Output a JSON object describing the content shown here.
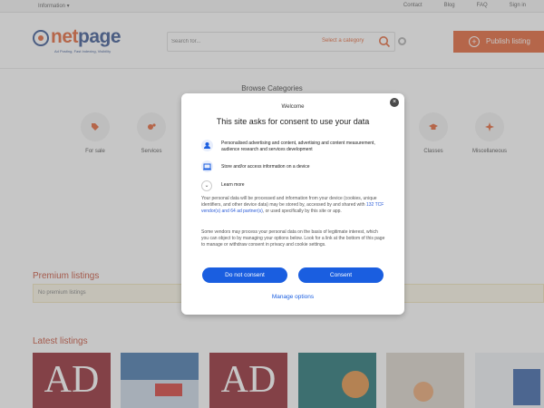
{
  "topbar": {
    "info_label": "Information",
    "links": [
      "Contact",
      "Blog",
      "FAQ",
      "Sign in"
    ]
  },
  "header": {
    "logo_part1": "net",
    "logo_part2": "page",
    "logo_tagline": "Ad Posting, Fast Indexing, Visibility",
    "search_placeholder": "Search for...",
    "category_select": "Select a category",
    "publish_label": "Publish listing",
    "accent_color": "#e25b2a"
  },
  "categories": {
    "title": "Browse Categories",
    "items": [
      {
        "label": "For sale",
        "icon": "tag-icon"
      },
      {
        "label": "Services",
        "icon": "gears-icon"
      },
      {
        "label": "Classes",
        "icon": "graduation-cap-icon"
      },
      {
        "label": "Miscellaneous",
        "icon": "burst-icon"
      }
    ]
  },
  "premium": {
    "title": "Premium listings",
    "empty_text": "No premium listings"
  },
  "latest": {
    "title": "Latest listings",
    "thumb_text": "AD",
    "thumb_text2": "AD"
  },
  "modal": {
    "welcome": "Welcome",
    "title": "This site asks for consent to use your data",
    "purpose1": "Personalised advertising and content, advertising and content measurement, audience research and services development",
    "purpose2": "Store and/or access information on a device",
    "learn_more": "Learn more",
    "para1_pre": "Your personal data will be processed and information from your device (cookies, unique identifiers, and other device data) may be stored by, accessed by and shared with ",
    "para1_link": "132 TCF vendor(s) and 64 ad partner(s)",
    "para1_post": ", or used specifically by this site or app.",
    "para2": "Some vendors may process your personal data on the basis of legitimate interest, which you can object to by managing your options below. Look for a link at the bottom of this page to manage or withdraw consent in privacy and cookie settings.",
    "do_not_consent": "Do not consent",
    "consent": "Consent",
    "manage_options": "Manage options",
    "button_color": "#1a5ee0"
  }
}
